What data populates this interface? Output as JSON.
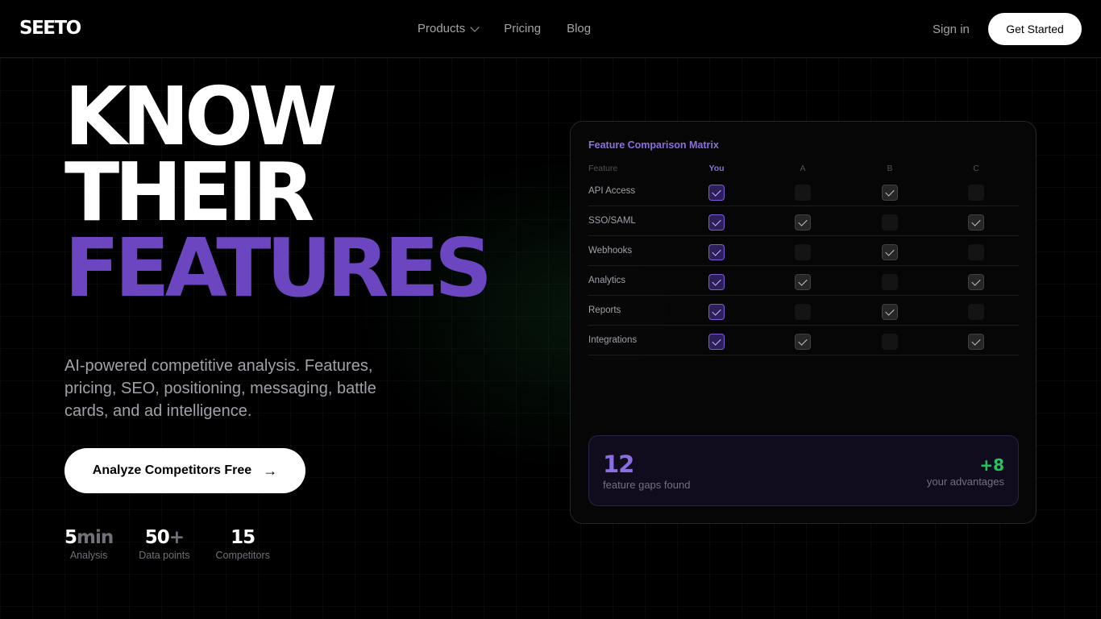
{
  "brand": {
    "logo": "SEETO"
  },
  "nav": {
    "items": [
      {
        "label": "Products",
        "has_dropdown": true
      },
      {
        "label": "Pricing"
      },
      {
        "label": "Blog"
      }
    ],
    "sign_in": "Sign in",
    "cta": "Get Started"
  },
  "hero": {
    "title_lines": [
      "KNOW",
      "THEIR",
      "FEATURES"
    ],
    "subtitle": "AI-powered competitive analysis. Features, pricing, SEO, positioning, messaging, battle cards, and ad intelligence.",
    "cta": "Analyze Competitors Free",
    "cta_icon": "arrow-right-icon",
    "stats": [
      {
        "value": "5",
        "suffix": "min",
        "label": "Analysis"
      },
      {
        "value": "50",
        "suffix": "+",
        "label": "Data points"
      },
      {
        "value": "15",
        "suffix": "",
        "label": "Competitors"
      }
    ]
  },
  "matrix": {
    "title": "Feature Comparison Matrix",
    "header": {
      "feature": "Feature",
      "columns": [
        "You",
        "A",
        "B",
        "C"
      ]
    },
    "rows": [
      {
        "feature": "API Access",
        "checks": [
          true,
          false,
          true,
          false
        ]
      },
      {
        "feature": "SSO/SAML",
        "checks": [
          true,
          true,
          false,
          true
        ]
      },
      {
        "feature": "Webhooks",
        "checks": [
          true,
          false,
          true,
          false
        ]
      },
      {
        "feature": "Analytics",
        "checks": [
          true,
          true,
          false,
          true
        ]
      },
      {
        "feature": "Reports",
        "checks": [
          true,
          false,
          true,
          false
        ]
      },
      {
        "feature": "Integrations",
        "checks": [
          true,
          true,
          false,
          true
        ]
      }
    ],
    "summary": {
      "gaps_value": "12",
      "gaps_label": "feature gaps found",
      "advantages_value": "+8",
      "advantages_label": "your advantages"
    }
  },
  "colors": {
    "accent": "#6c46c0",
    "accent_light": "#8b6fe0",
    "positive": "#22c55e",
    "background": "#000000"
  }
}
